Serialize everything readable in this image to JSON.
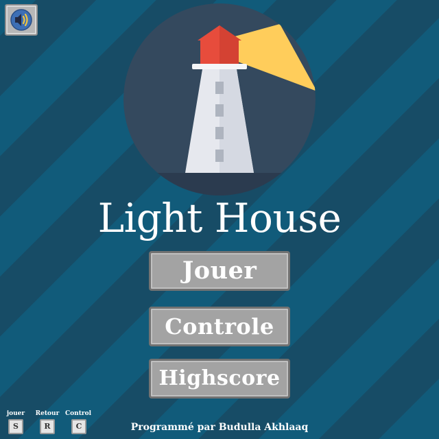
{
  "title": "Light House",
  "menu": {
    "play": "Jouer",
    "controls": "Controle",
    "highscore": "Highscore"
  },
  "shortcuts": [
    {
      "label": "jouer",
      "key": "S"
    },
    {
      "label": "Retour",
      "key": "R"
    },
    {
      "label": "Control",
      "key": "C"
    }
  ],
  "credit": "Programmé par Budulla Akhlaaq",
  "icons": {
    "sound": "speaker-volume-icon",
    "logo": "lighthouse-icon"
  },
  "colors": {
    "background_stripe_light": "#115b7a",
    "background_stripe_dark": "#174c66",
    "logo_circle": "#34495e",
    "beam": "#ffcc5c",
    "lamp": "#e74c3c",
    "tower": "#e8eaef",
    "button_face": "#a3a3a3",
    "button_border": "#727272"
  }
}
